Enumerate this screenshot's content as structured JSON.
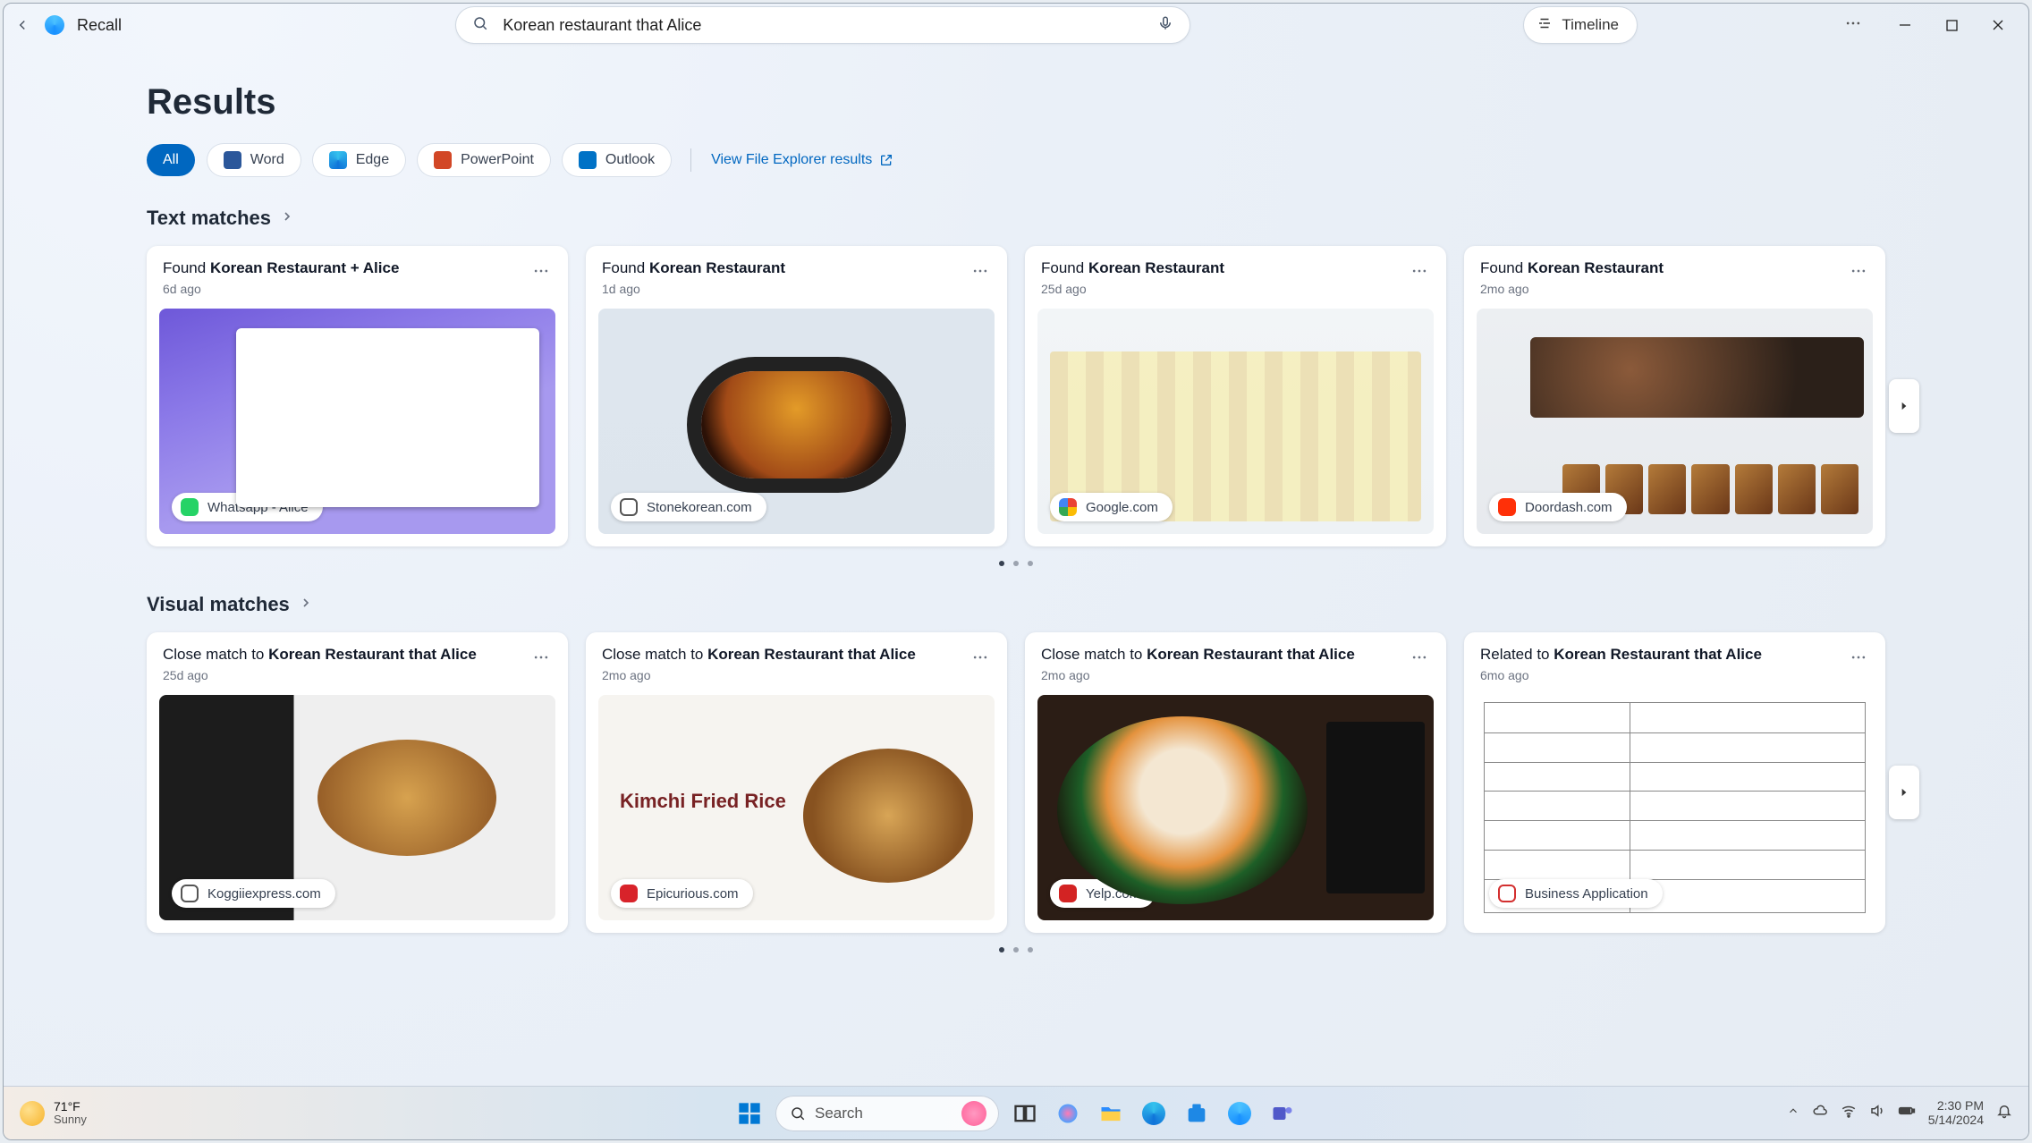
{
  "app": {
    "name": "Recall"
  },
  "search": {
    "query": "Korean restaurant that Alice",
    "placeholder": ""
  },
  "timeline_btn": "Timeline",
  "page_title": "Results",
  "filters": {
    "all": "All",
    "word": "Word",
    "edge": "Edge",
    "ppt": "PowerPoint",
    "outlook": "Outlook",
    "fe_link": "View File Explorer results"
  },
  "sections": {
    "text": "Text matches",
    "visual": "Visual matches"
  },
  "text_cards": [
    {
      "prefix": "Found ",
      "bold": "Korean Restaurant + Alice",
      "age": "6d ago",
      "src": "Whatsapp - Alice"
    },
    {
      "prefix": "Found ",
      "bold": "Korean Restaurant",
      "age": "1d ago",
      "src": "Stonekorean.com"
    },
    {
      "prefix": "Found ",
      "bold": "Korean Restaurant",
      "age": "25d ago",
      "src": "Google.com"
    },
    {
      "prefix": "Found ",
      "bold": "Korean Restaurant",
      "age": "2mo ago",
      "src": "Doordash.com"
    }
  ],
  "visual_cards": [
    {
      "prefix": "Close match to ",
      "bold": "Korean Restaurant that Alice",
      "age": "25d ago",
      "src": "Koggiiexpress.com"
    },
    {
      "prefix": "Close match to ",
      "bold": "Korean Restaurant that Alice",
      "age": "2mo ago",
      "src": "Epicurious.com"
    },
    {
      "prefix": "Close match to ",
      "bold": "Korean Restaurant that Alice",
      "age": "2mo ago",
      "src": "Yelp.com"
    },
    {
      "prefix": "Related to ",
      "bold": "Korean Restaurant that Alice",
      "age": "6mo ago",
      "src": "Business Application"
    }
  ],
  "kfr_label": "Kimchi Fried Rice",
  "weather": {
    "temp": "71°F",
    "cond": "Sunny"
  },
  "taskbar_search": "Search",
  "clock": {
    "time": "2:30 PM",
    "date": "5/14/2024"
  }
}
